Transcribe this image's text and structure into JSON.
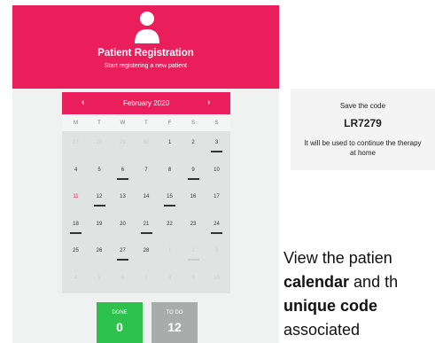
{
  "header": {
    "title": "Patient Registration",
    "subtitle": "Start registering a new patient"
  },
  "calendar": {
    "prev": "‹",
    "next": "›",
    "month": "February 2020",
    "weekdays": [
      "M",
      "T",
      "W",
      "T",
      "F",
      "S",
      "S"
    ],
    "weeks": [
      [
        {
          "d": "27",
          "o": 1
        },
        {
          "d": "28",
          "o": 1
        },
        {
          "d": "29",
          "o": 1
        },
        {
          "d": "30",
          "o": 1
        },
        {
          "d": "1"
        },
        {
          "d": "2"
        },
        {
          "d": "3",
          "b": 1
        }
      ],
      [
        {
          "d": "4"
        },
        {
          "d": "5"
        },
        {
          "d": "6",
          "b": 1
        },
        {
          "d": "7"
        },
        {
          "d": "8"
        },
        {
          "d": "9",
          "b": 1
        },
        {
          "d": "10"
        }
      ],
      [
        {
          "d": "11",
          "r": 1
        },
        {
          "d": "12",
          "b": 1
        },
        {
          "d": "13"
        },
        {
          "d": "14"
        },
        {
          "d": "15",
          "b": 1
        },
        {
          "d": "16"
        },
        {
          "d": "17"
        }
      ],
      [
        {
          "d": "18",
          "b": 1
        },
        {
          "d": "19"
        },
        {
          "d": "20"
        },
        {
          "d": "21",
          "b": 1
        },
        {
          "d": "22"
        },
        {
          "d": "23"
        },
        {
          "d": "24",
          "b": 1
        }
      ],
      [
        {
          "d": "25"
        },
        {
          "d": "26"
        },
        {
          "d": "27",
          "b": 1
        },
        {
          "d": "28"
        },
        {
          "d": "1",
          "o": 1
        },
        {
          "d": "2",
          "o": 1,
          "b": 1
        },
        {
          "d": "3",
          "o": 1
        }
      ],
      [
        {
          "d": "4",
          "o": 1
        },
        {
          "d": "5",
          "o": 1
        },
        {
          "d": "6",
          "o": 1
        },
        {
          "d": "7",
          "o": 1
        },
        {
          "d": "8",
          "o": 1
        },
        {
          "d": "9",
          "o": 1
        },
        {
          "d": "10",
          "o": 1
        }
      ]
    ]
  },
  "stats": {
    "done_label": "DONE",
    "done_value": "0",
    "todo_label": "TO DO",
    "todo_value": "12"
  },
  "code_card": {
    "line1": "Save the code",
    "code": "LR7279",
    "line3": "It will be used to continue the therapy at home"
  },
  "side_text": {
    "line1": "View the patien",
    "line2_bold": "calendar",
    "line2_rest": " and th",
    "line3_bold": "unique code",
    "line4": "associated"
  }
}
